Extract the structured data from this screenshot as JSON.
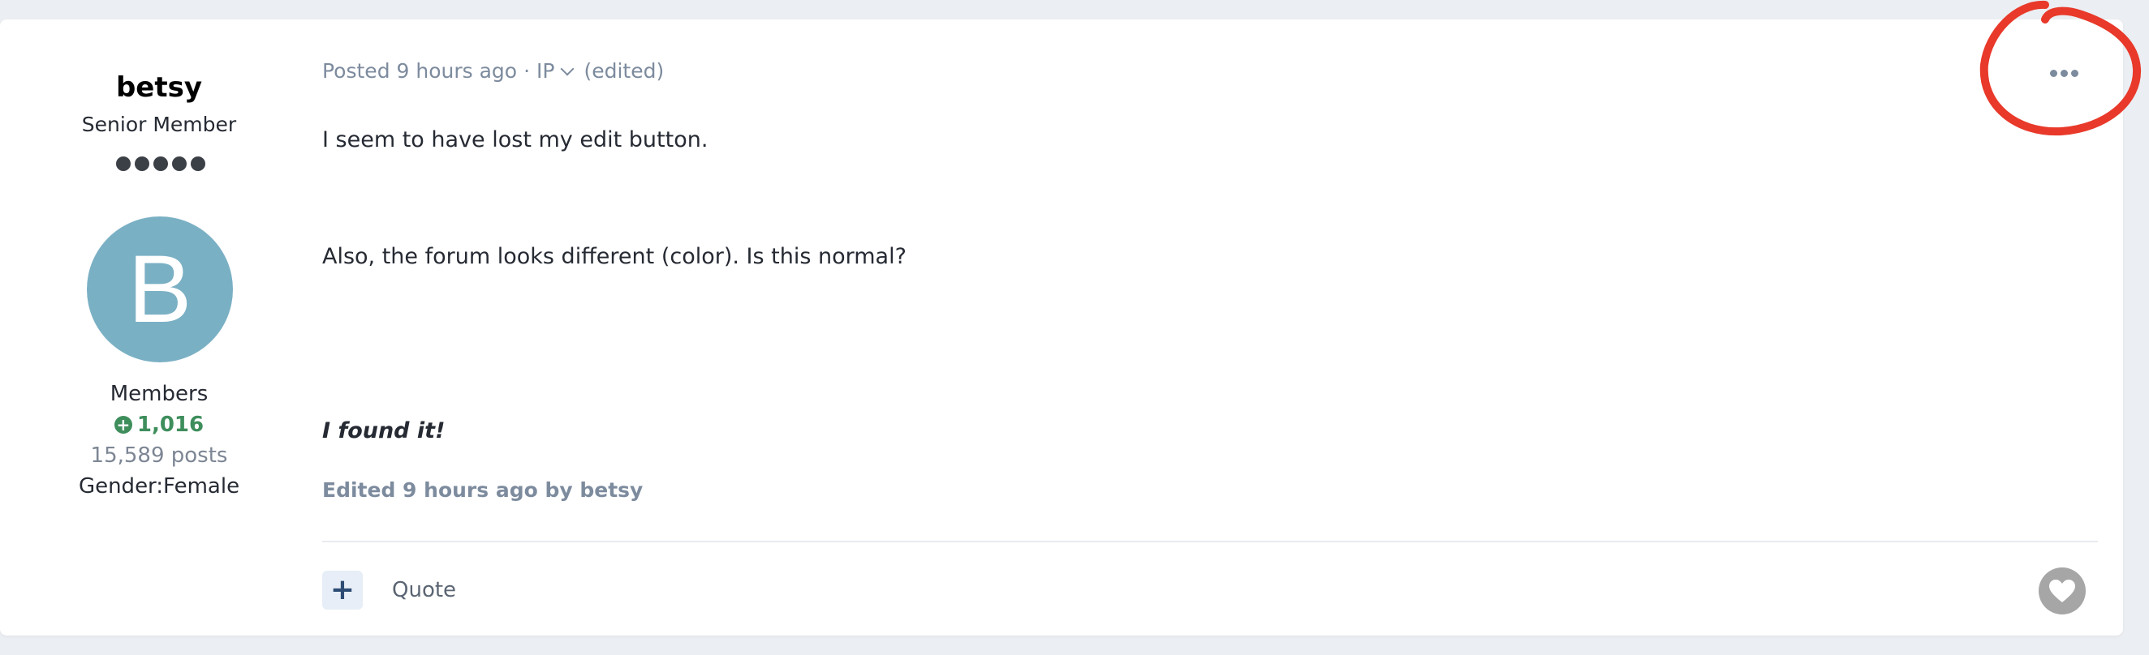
{
  "author": {
    "name": "betsy",
    "title": "Senior Member",
    "rank_pips": 5,
    "avatar_letter": "B",
    "avatar_color": "#7ab0c4",
    "group": "Members",
    "reputation": "1,016",
    "reputation_color": "#3e8e5c",
    "posts": "15,589 posts",
    "gender": "Gender:Female"
  },
  "post": {
    "meta_posted": "Posted 9 hours ago",
    "meta_sep": "·",
    "meta_ip": "IP",
    "meta_edited": "(edited)",
    "paragraphs": [
      "I seem to have lost my edit button.",
      "Also, the forum looks different (color).   Is this normal?",
      "I found it!"
    ],
    "edited_note": "Edited 9 hours ago by betsy"
  },
  "actions": {
    "multiquote_symbol": "+",
    "quote_label": "Quote",
    "menu_icon": "ellipsis-icon",
    "like_icon": "heart-icon"
  },
  "colors": {
    "annotation_red": "#e8392a",
    "meta_text": "#7d8b9e"
  }
}
